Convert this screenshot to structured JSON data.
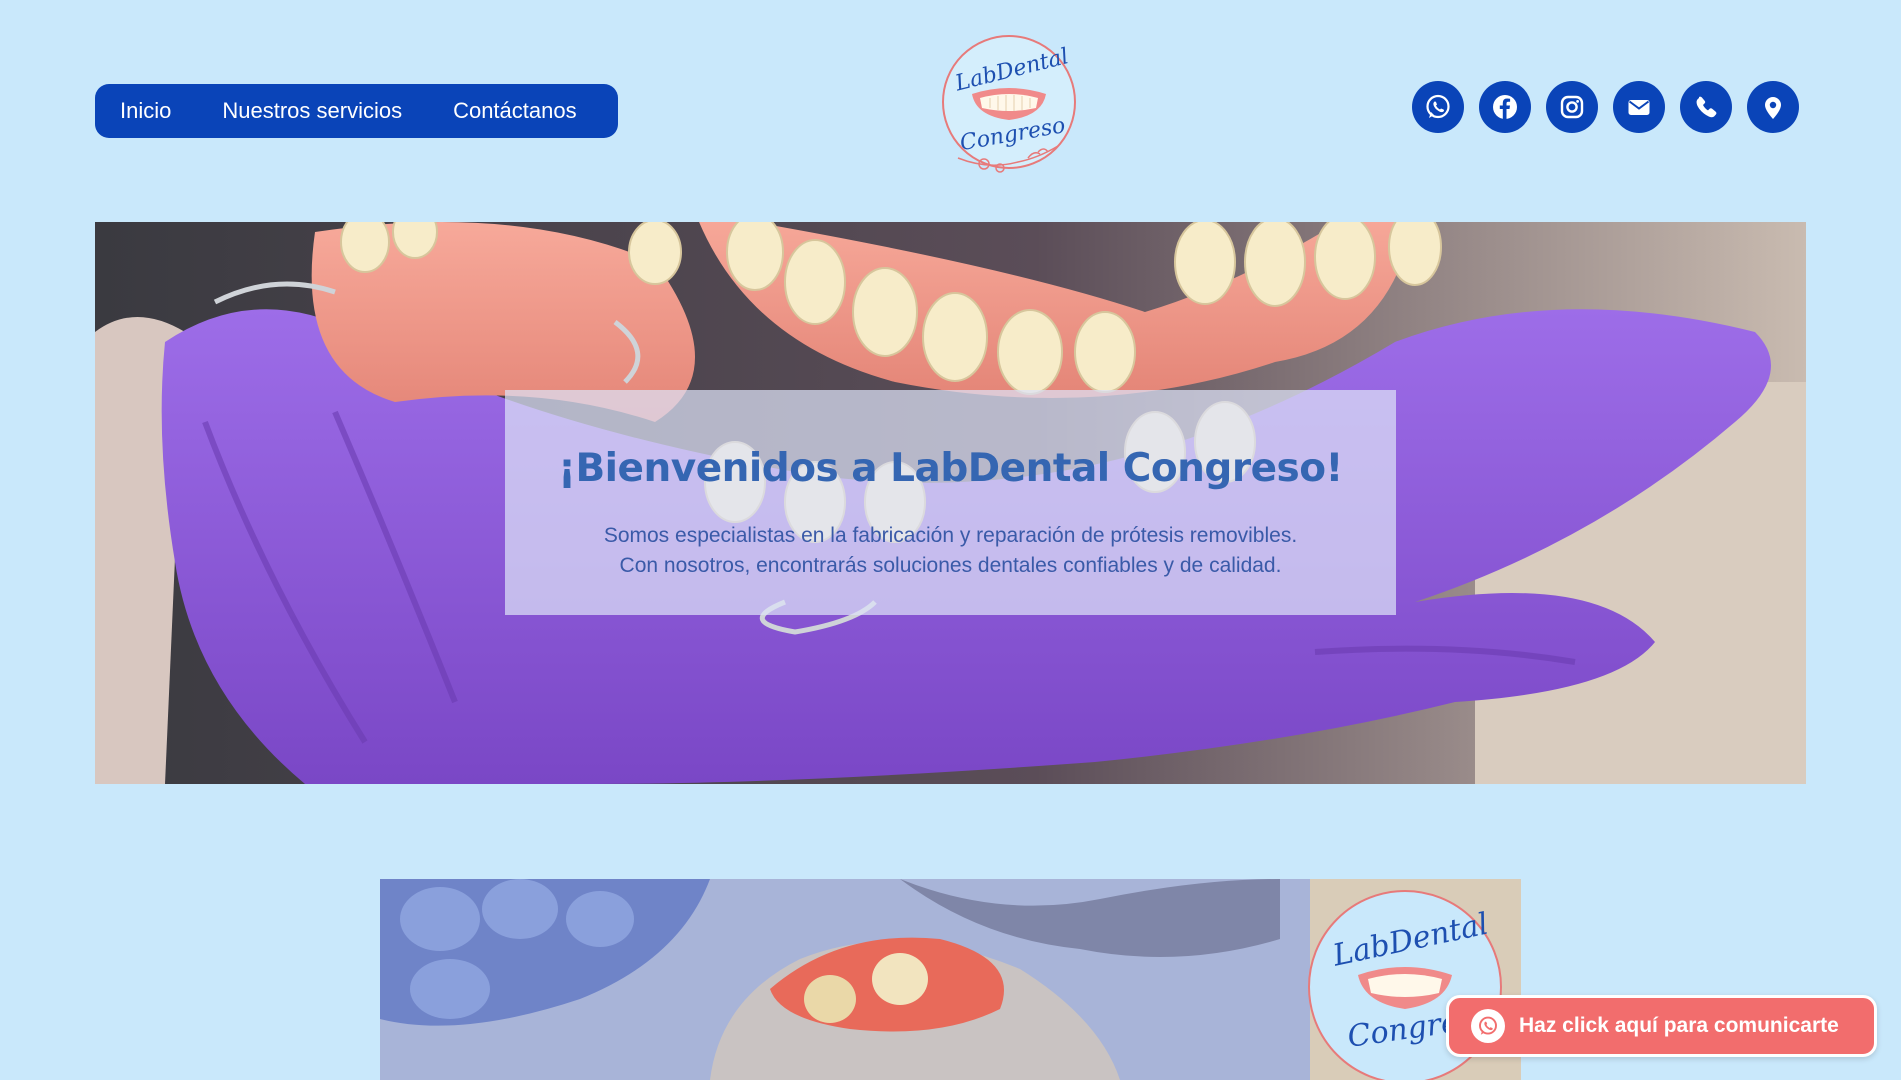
{
  "nav": {
    "items": [
      "Inicio",
      "Nuestros servicios",
      "Contáctanos"
    ]
  },
  "logo": {
    "line1": "LabDental",
    "line2": "Congreso"
  },
  "social": [
    {
      "icon": "whatsapp-icon"
    },
    {
      "icon": "facebook-icon"
    },
    {
      "icon": "instagram-icon"
    },
    {
      "icon": "email-icon"
    },
    {
      "icon": "phone-icon"
    },
    {
      "icon": "location-pin-icon"
    }
  ],
  "hero": {
    "title": "¡Bienvenidos a LabDental Congreso!",
    "text_line1": "Somos especialistas en la fabricación y reparación de prótesis removibles.",
    "text_line2": "Con nosotros, encontrarás soluciones dentales confiables y de calidad."
  },
  "cta": {
    "label": "Haz click aquí para comunicarte",
    "icon": "whatsapp-icon"
  },
  "colors": {
    "page_background": "#c9e8fb",
    "brand_blue": "#0a44b8",
    "hero_title": "#3566b2",
    "cta_background": "#f26d6d",
    "glove_purple": "#8a57d6"
  }
}
